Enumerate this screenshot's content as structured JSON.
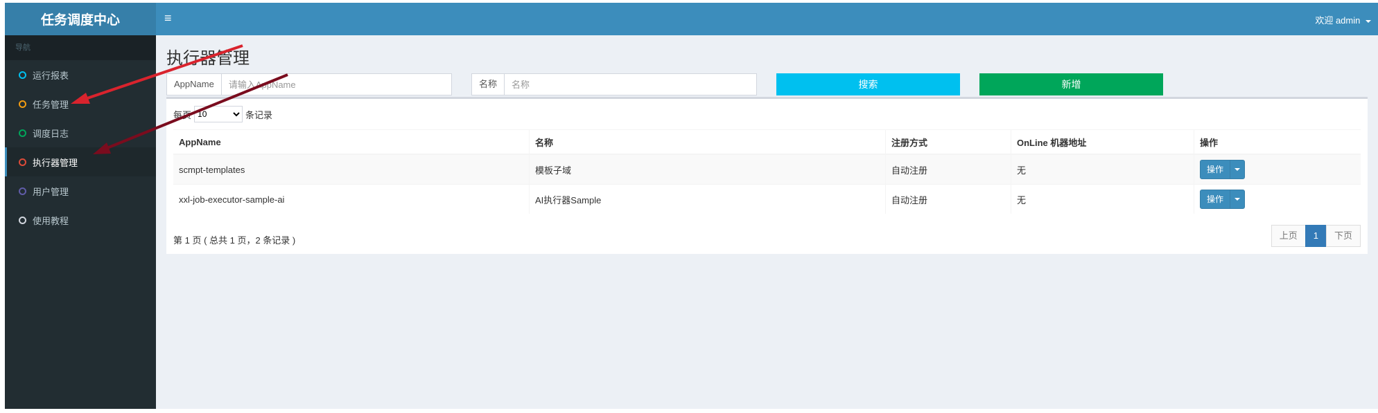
{
  "header": {
    "logo": "任务调度中心",
    "menu_icon": "≡",
    "user": "欢迎 admin"
  },
  "sidebar": {
    "nav_label": "导航",
    "items": [
      {
        "label": "运行报表",
        "color": "#00c0ef"
      },
      {
        "label": "任务管理",
        "color": "#f39c12"
      },
      {
        "label": "调度日志",
        "color": "#00a65a"
      },
      {
        "label": "执行器管理",
        "color": "#dd4b39"
      },
      {
        "label": "用户管理",
        "color": "#605ca8"
      },
      {
        "label": "使用教程",
        "color": "#d2d6de"
      }
    ]
  },
  "main": {
    "title": "执行器管理",
    "search": {
      "appname_label": "AppName",
      "appname_placeholder": "请输入AppName",
      "name_label": "名称",
      "name_placeholder": "名称",
      "search_button": "搜索",
      "add_button": "新增"
    },
    "page_length": {
      "prefix": "每页",
      "value": "10",
      "suffix": "条记录"
    },
    "table": {
      "columns": [
        "AppName",
        "名称",
        "注册方式",
        "OnLine 机器地址",
        "操作"
      ],
      "rows": [
        {
          "appname": "scmpt-templates",
          "name": "模板子域",
          "reg": "自动注册",
          "online": "无",
          "op": "操作"
        },
        {
          "appname": "xxl-job-executor-sample-ai",
          "name": "AI执行器Sample",
          "reg": "自动注册",
          "online": "无",
          "op": "操作"
        }
      ]
    },
    "info": "第 1 页 ( 总共 1 页，2 条记录 )",
    "pagination": {
      "prev": "上页",
      "current": "1",
      "next": "下页"
    }
  },
  "colors": {
    "navbar": "#3c8dbc",
    "sidebar": "#222d32",
    "search_btn": "#00c0ef",
    "add_btn": "#00a65a",
    "annotation_arrow_1": "#d9232d",
    "annotation_arrow_2": "#7a0c1e"
  }
}
